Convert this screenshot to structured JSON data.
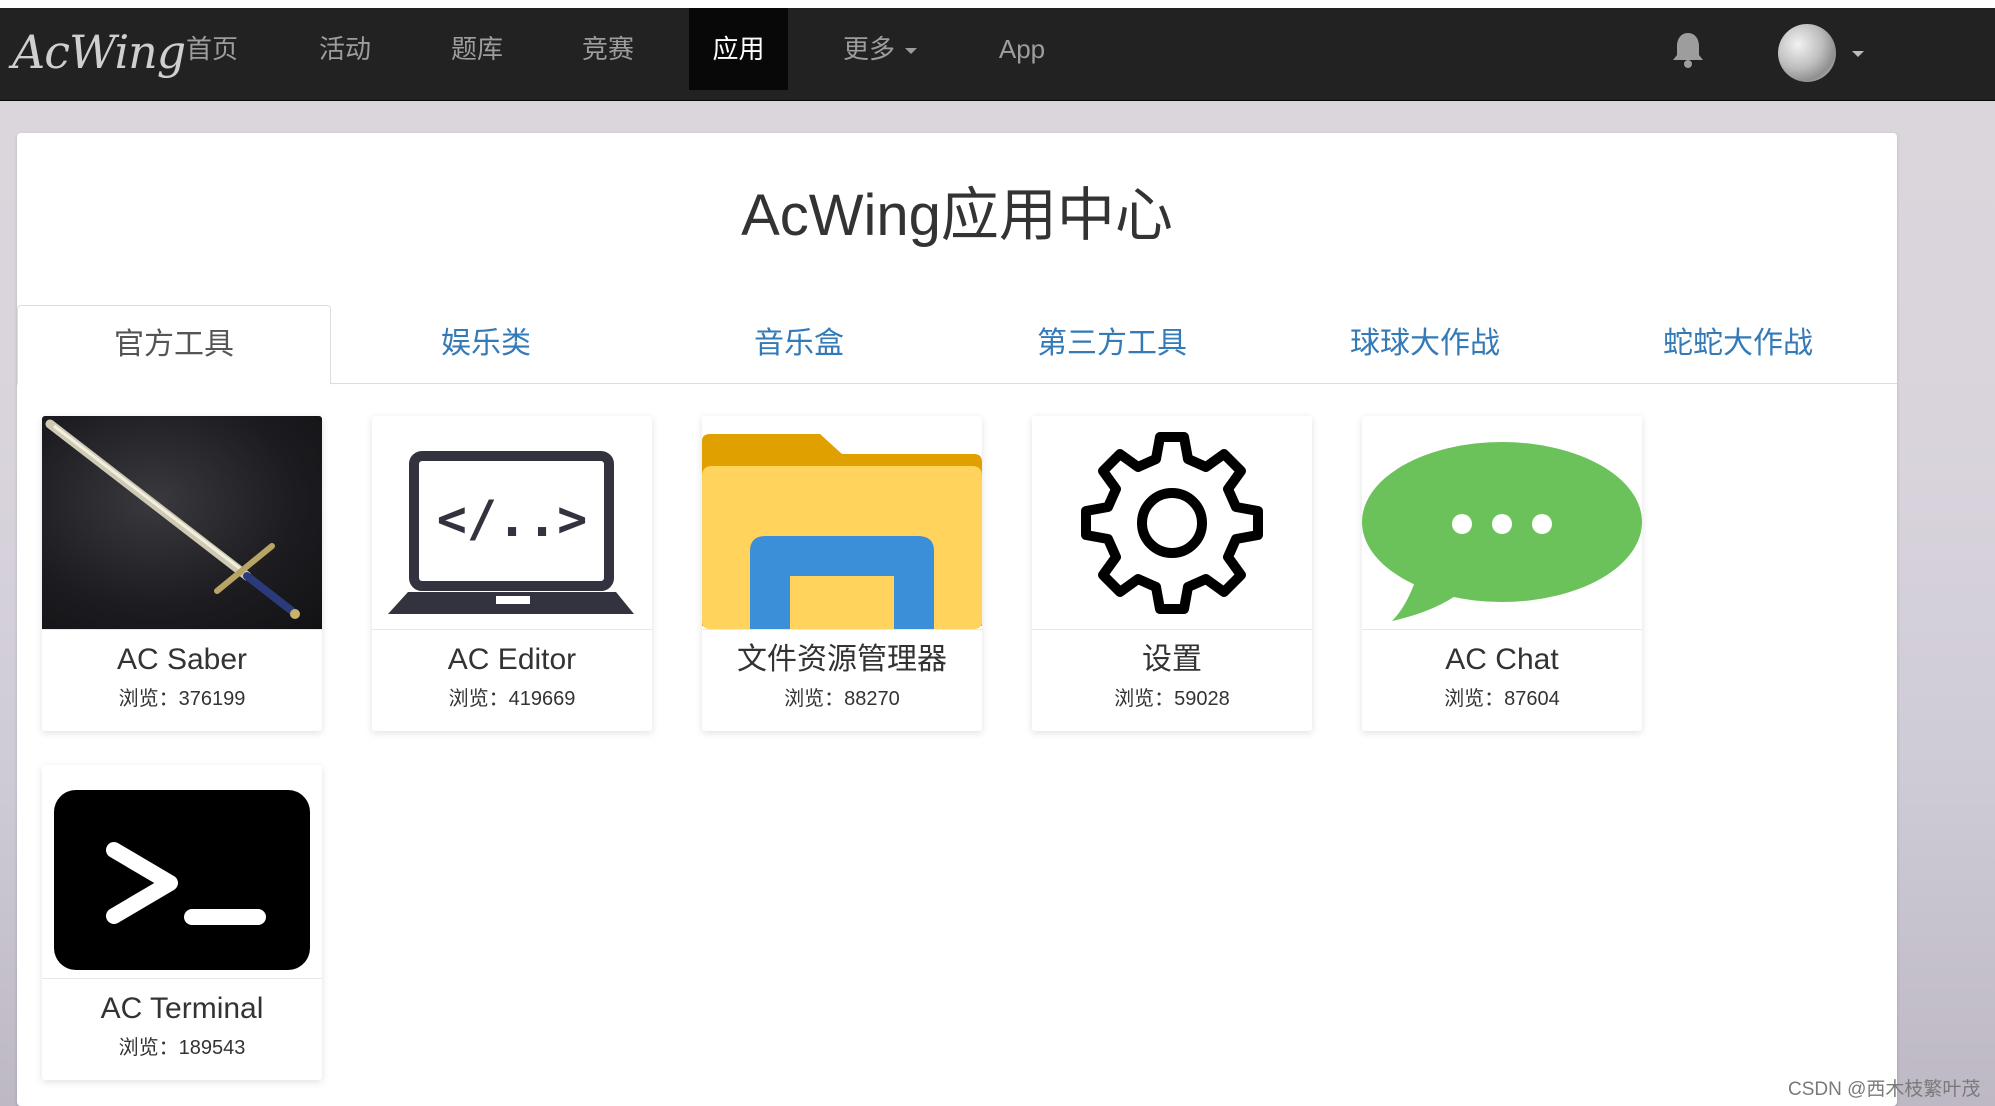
{
  "navbar": {
    "brand": "AcWing",
    "items": [
      {
        "label": "首页"
      },
      {
        "label": "活动"
      },
      {
        "label": "题库"
      },
      {
        "label": "竞赛"
      },
      {
        "label": "应用",
        "active": true
      },
      {
        "label": "更多",
        "dropdown": true
      },
      {
        "label": "App"
      }
    ],
    "icons": [
      "bell-icon",
      "avatar",
      "chevron-down-icon"
    ],
    "colors": {
      "background": "#222222",
      "text": "#9d9d9d",
      "active_bg": "#080808",
      "active_text": "#ffffff"
    }
  },
  "main": {
    "title": "AcWing应用中心",
    "tabs": [
      {
        "label": "官方工具",
        "active": true
      },
      {
        "label": "娱乐类"
      },
      {
        "label": "音乐盒"
      },
      {
        "label": "第三方工具"
      },
      {
        "label": "球球大作战"
      },
      {
        "label": "蛇蛇大作战"
      }
    ],
    "apps": [
      {
        "name": "AC Saber",
        "views": "浏览：376199",
        "icon": "sword-icon"
      },
      {
        "name": "AC Editor",
        "views": "浏览：419669",
        "icon": "laptop-code-icon"
      },
      {
        "name": "文件资源管理器",
        "views": "浏览：88270",
        "icon": "folder-icon"
      },
      {
        "name": "设置",
        "views": "浏览：59028",
        "icon": "gear-icon"
      },
      {
        "name": "AC Chat",
        "views": "浏览：87604",
        "icon": "chat-bubble-icon"
      },
      {
        "name": "AC Terminal",
        "views": "浏览：189543",
        "icon": "terminal-icon"
      }
    ],
    "colors": {
      "tab_link": "#337ab7",
      "title": "#333333"
    }
  },
  "watermark": "CSDN @西木枝繁叶茂"
}
